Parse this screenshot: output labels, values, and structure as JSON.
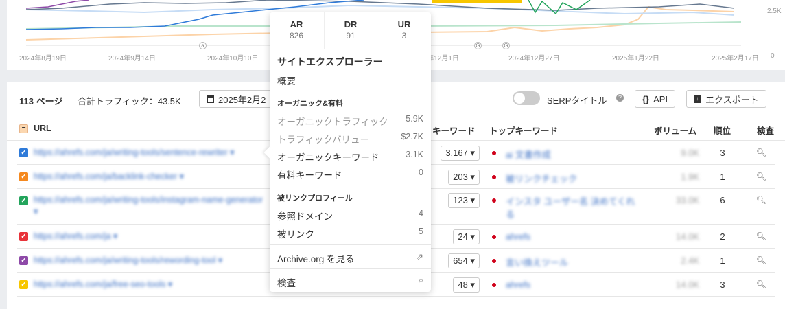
{
  "chart": {
    "x_labels": [
      "2024年8月19日",
      "2024年9月14日",
      "2024年10月10日",
      "2024年12月1日",
      "2024年12月27日",
      "2025年1月22日",
      "2025年2月17日"
    ],
    "y_labels": [
      "2.5K",
      "0"
    ],
    "annotations": [
      "a",
      "G",
      "G"
    ]
  },
  "toolbar": {
    "pages": "113 ページ",
    "total_traffic": "合計トラフィック：43.5K",
    "date": "2025年2月2",
    "serp_label": "SERPタイトル",
    "api_label": "API",
    "export_label": "エクスポート"
  },
  "table": {
    "headers": {
      "url": "URL",
      "keywords": "キーワード",
      "top_keyword": "トップキーワード",
      "volume": "ボリューム",
      "rank": "順位",
      "inspect": "検査"
    },
    "rows": [
      {
        "color": "#2f7bd9",
        "url": "https://ahrefs.com/ja/writing-tools/sentence-rewriter ▾",
        "keywords": "3,167 ▾",
        "top_keyword": "ai 文書作成",
        "volume": "9.0K",
        "rank": "3"
      },
      {
        "color": "#f5891f",
        "url": "https://ahrefs.com/ja/backlink-checker ▾",
        "keywords": "203 ▾",
        "top_keyword": "被リンクチェック",
        "volume": "1.9K",
        "rank": "1"
      },
      {
        "color": "#23a45c",
        "url": "https://ahrefs.com/ja/writing-tools/instagram-name-generator ▾",
        "keywords": "123 ▾",
        "top_keyword": "インスタ ユーザー名 決めてくれる",
        "volume": "33.0K",
        "rank": "6"
      },
      {
        "color": "#e8333a",
        "url": "https://ahrefs.com/ja ▾",
        "keywords": "24 ▾",
        "top_keyword": "ahrefs",
        "volume": "14.0K",
        "rank": "2"
      },
      {
        "color": "#8e4aa8",
        "url": "https://ahrefs.com/ja/writing-tools/rewording-tool ▾",
        "keywords": "654 ▾",
        "top_keyword": "言い換えツール",
        "volume": "2.4K",
        "rank": "1"
      },
      {
        "color": "#f7c600",
        "url": "https://ahrefs.com/ja/free-seo-tools ▾",
        "keywords": "48 ▾",
        "top_keyword": "ahrefs",
        "volume": "14.0K",
        "rank": "3"
      }
    ]
  },
  "popup": {
    "metrics": [
      {
        "label": "AR",
        "value": "826"
      },
      {
        "label": "DR",
        "value": "91"
      },
      {
        "label": "UR",
        "value": "3"
      }
    ],
    "title": "サイトエクスプローラー",
    "overview": "概要",
    "section1": "オーガニック&有料",
    "items1": [
      {
        "label": "オーガニックトラフィック",
        "value": "5.9K"
      },
      {
        "label": "トラフィックバリュー",
        "value": "$2.7K"
      },
      {
        "label": "オーガニックキーワード",
        "value": "3.1K"
      },
      {
        "label": "有料キーワード",
        "value": "0"
      }
    ],
    "section2": "被リンクプロフィール",
    "items2": [
      {
        "label": "参照ドメイン",
        "value": "4"
      },
      {
        "label": "被リンク",
        "value": "5"
      }
    ],
    "archive": "Archive.org を見る",
    "inspect": "検査"
  }
}
